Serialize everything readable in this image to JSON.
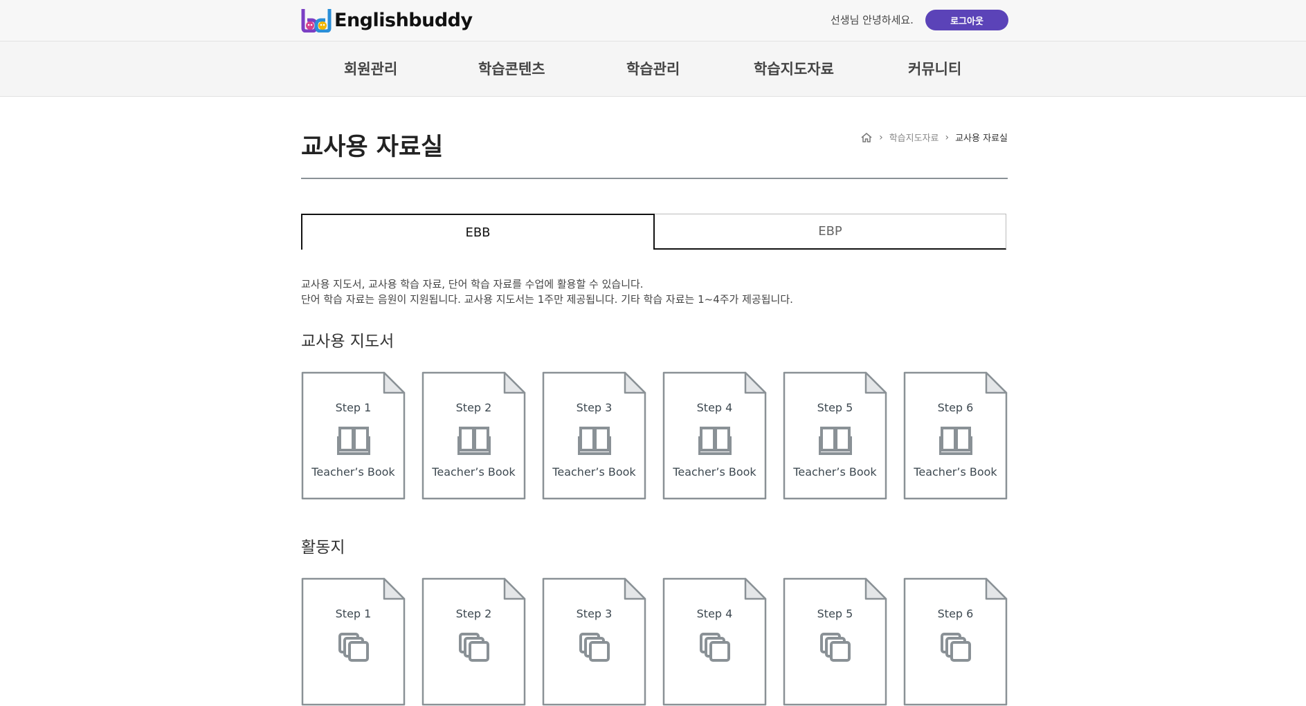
{
  "header": {
    "logo_text": "Englishbuddy",
    "greeting": "선생님 안녕하세요.",
    "logout_label": "로그아웃"
  },
  "nav": {
    "items": [
      {
        "label": "회원관리"
      },
      {
        "label": "학습콘텐츠"
      },
      {
        "label": "학습관리"
      },
      {
        "label": "학습지도자료"
      },
      {
        "label": "커뮤니티"
      }
    ]
  },
  "page": {
    "title": "교사용 자료실",
    "breadcrumb": {
      "parent": "학습지도자료",
      "current": "교사용 자료실"
    }
  },
  "tabs": [
    {
      "label": "EBB",
      "active": true
    },
    {
      "label": "EBP",
      "active": false
    }
  ],
  "description": {
    "line1": "교사용 지도서, 교사용 학습 자료, 단어 학습 자료를 수업에 활용할 수 있습니다.",
    "line2": "단어 학습 자료는 음원이 지원됩니다. 교사용 지도서는 1주만 제공됩니다. 기타 학습 자료는 1~4주가 제공됩니다."
  },
  "sections": [
    {
      "title": "교사용 지도서",
      "icon": "open-book-icon",
      "cards": [
        {
          "step": "Step 1",
          "label": "Teacher’s Book"
        },
        {
          "step": "Step 2",
          "label": "Teacher’s Book"
        },
        {
          "step": "Step 3",
          "label": "Teacher’s Book"
        },
        {
          "step": "Step 4",
          "label": "Teacher’s Book"
        },
        {
          "step": "Step 5",
          "label": "Teacher’s Book"
        },
        {
          "step": "Step 6",
          "label": "Teacher’s Book"
        }
      ]
    },
    {
      "title": "활동지",
      "icon": "stacked-pages-icon",
      "cards": [
        {
          "step": "Step 1",
          "label": ""
        },
        {
          "step": "Step 2",
          "label": ""
        },
        {
          "step": "Step 3",
          "label": ""
        },
        {
          "step": "Step 4",
          "label": ""
        },
        {
          "step": "Step 5",
          "label": ""
        },
        {
          "step": "Step 6",
          "label": ""
        }
      ]
    }
  ],
  "colors": {
    "brand_purple": "#5b43b8",
    "card_stroke": "#8a9196",
    "card_fold": "#e4e6e8"
  }
}
